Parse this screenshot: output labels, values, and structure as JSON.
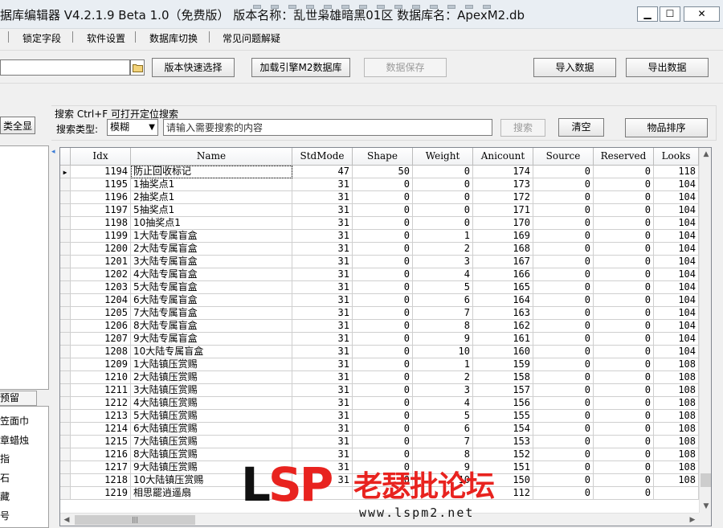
{
  "window": {
    "title": "据库编辑器 V4.2.1.9   Beta 1.0（免费版）   版本名称：乱世枭雄暗黑01区    数据库名：ApexM2.db",
    "min_label": "▁",
    "max_label": "☐",
    "close_label": "✕"
  },
  "menu": {
    "items": [
      "锁定字段",
      "软件设置",
      "数据库切换",
      "常见问题解疑"
    ]
  },
  "toolbar": {
    "version_select": "版本快速选择",
    "load_engine_db": "加载引擎M2数据库",
    "save_data": "数据保存",
    "import_data": "导入数据",
    "export_data": "导出数据"
  },
  "search": {
    "title": "搜索   Ctrl+F 可打开定位搜索",
    "type_label": "搜索类型:",
    "type_value": "模糊",
    "placeholder": "请输入需要搜索的内容",
    "search_button": "搜索",
    "clear_button": "清空",
    "sort_button": "物品排序"
  },
  "left_pane": {
    "show_all_button": "类全显",
    "tab_label": "预留",
    "items": [
      "笠面巾",
      "章蜡烛",
      "指",
      "石",
      "藏",
      "号"
    ]
  },
  "grid": {
    "columns": [
      "Idx",
      "Name",
      "StdMode",
      "Shape",
      "Weight",
      "Anicount",
      "Source",
      "Reserved",
      "Looks"
    ],
    "selected_index": 0,
    "rows": [
      [
        "1194",
        "防止回收标记",
        "47",
        "50",
        "0",
        "174",
        "0",
        "0",
        "118"
      ],
      [
        "1195",
        "1抽奖点1",
        "31",
        "0",
        "0",
        "173",
        "0",
        "0",
        "104"
      ],
      [
        "1196",
        "2抽奖点1",
        "31",
        "0",
        "0",
        "172",
        "0",
        "0",
        "104"
      ],
      [
        "1197",
        "5抽奖点1",
        "31",
        "0",
        "0",
        "171",
        "0",
        "0",
        "104"
      ],
      [
        "1198",
        "10抽奖点1",
        "31",
        "0",
        "0",
        "170",
        "0",
        "0",
        "104"
      ],
      [
        "1199",
        "1大陆专属盲盒",
        "31",
        "0",
        "1",
        "169",
        "0",
        "0",
        "104"
      ],
      [
        "1200",
        "2大陆专属盲盒",
        "31",
        "0",
        "2",
        "168",
        "0",
        "0",
        "104"
      ],
      [
        "1201",
        "3大陆专属盲盒",
        "31",
        "0",
        "3",
        "167",
        "0",
        "0",
        "104"
      ],
      [
        "1202",
        "4大陆专属盲盒",
        "31",
        "0",
        "4",
        "166",
        "0",
        "0",
        "104"
      ],
      [
        "1203",
        "5大陆专属盲盒",
        "31",
        "0",
        "5",
        "165",
        "0",
        "0",
        "104"
      ],
      [
        "1204",
        "6大陆专属盲盒",
        "31",
        "0",
        "6",
        "164",
        "0",
        "0",
        "104"
      ],
      [
        "1205",
        "7大陆专属盲盒",
        "31",
        "0",
        "7",
        "163",
        "0",
        "0",
        "104"
      ],
      [
        "1206",
        "8大陆专属盲盒",
        "31",
        "0",
        "8",
        "162",
        "0",
        "0",
        "104"
      ],
      [
        "1207",
        "9大陆专属盲盒",
        "31",
        "0",
        "9",
        "161",
        "0",
        "0",
        "104"
      ],
      [
        "1208",
        "10大陆专属盲盒",
        "31",
        "0",
        "10",
        "160",
        "0",
        "0",
        "104"
      ],
      [
        "1209",
        "1大陆镇压赏赐",
        "31",
        "0",
        "1",
        "159",
        "0",
        "0",
        "108"
      ],
      [
        "1210",
        "2大陆镇压赏赐",
        "31",
        "0",
        "2",
        "158",
        "0",
        "0",
        "108"
      ],
      [
        "1211",
        "3大陆镇压赏赐",
        "31",
        "0",
        "3",
        "157",
        "0",
        "0",
        "108"
      ],
      [
        "1212",
        "4大陆镇压赏赐",
        "31",
        "0",
        "4",
        "156",
        "0",
        "0",
        "108"
      ],
      [
        "1213",
        "5大陆镇压赏赐",
        "31",
        "0",
        "5",
        "155",
        "0",
        "0",
        "108"
      ],
      [
        "1214",
        "6大陆镇压赏赐",
        "31",
        "0",
        "6",
        "154",
        "0",
        "0",
        "108"
      ],
      [
        "1215",
        "7大陆镇压赏赐",
        "31",
        "0",
        "7",
        "153",
        "0",
        "0",
        "108"
      ],
      [
        "1216",
        "8大陆镇压赏赐",
        "31",
        "0",
        "8",
        "152",
        "0",
        "0",
        "108"
      ],
      [
        "1217",
        "9大陆镇压赏赐",
        "31",
        "0",
        "9",
        "151",
        "0",
        "0",
        "108"
      ],
      [
        "1218",
        "10大陆镇压赏赐",
        "31",
        "0",
        "10",
        "150",
        "0",
        "0",
        "108"
      ],
      [
        "1219",
        "相思罷逍遥扇",
        "",
        "",
        "",
        "112",
        "0",
        "0",
        ""
      ]
    ]
  },
  "watermark": {
    "logo_l": "L",
    "logo_sp": "SP",
    "site_name": "老瑟批论坛",
    "url": "www.lspm2.net"
  }
}
